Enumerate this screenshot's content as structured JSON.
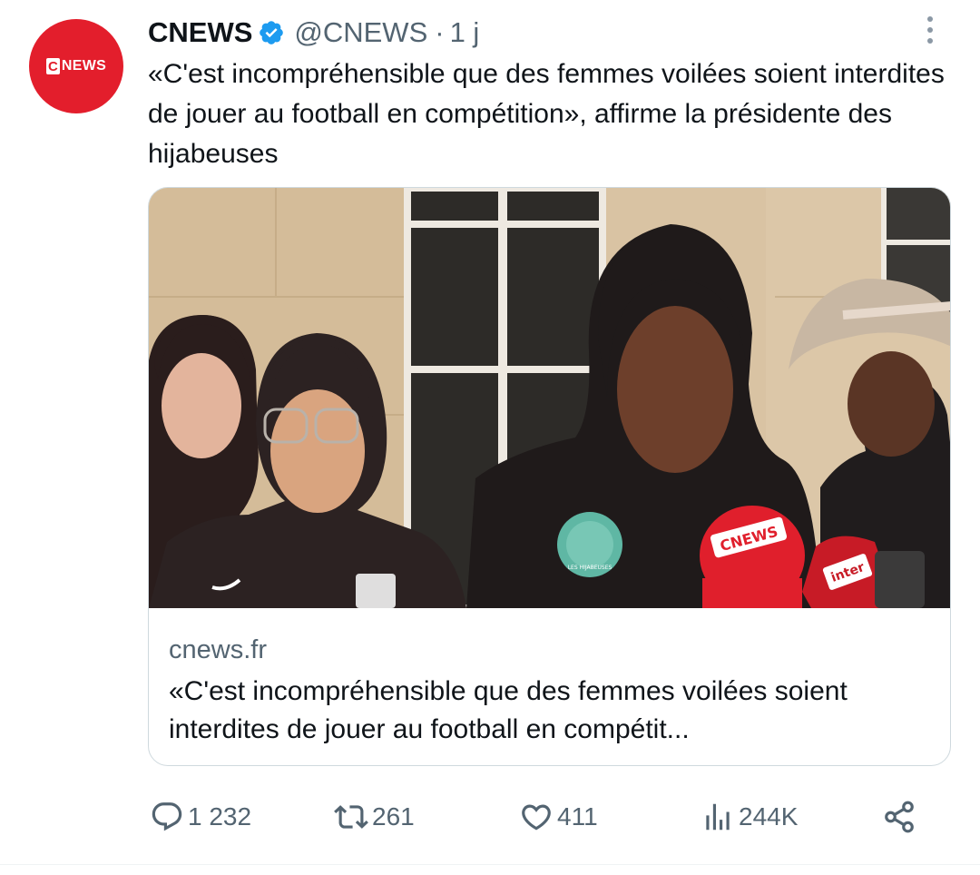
{
  "tweet": {
    "avatar": {
      "logo_c": "C",
      "logo_text": "NEWS",
      "bg_color": "#e31e2c"
    },
    "display_name": "CNEWS",
    "handle": "@CNEWS",
    "separator": "·",
    "timestamp": "1 j",
    "text": "«C'est incompréhensible que des femmes voilées soient interdites de jouer au football en compétition», affirme la présidente des hijabeuses",
    "verified_icon": "verified-badge-icon",
    "more_icon": "more-vertical-icon"
  },
  "card": {
    "domain": "cnews.fr",
    "title": "«C'est incompréhensible que des femmes voilées soient interdites de jouer au football en compétit...",
    "image": {
      "mic1_label": "CNEWS",
      "mic2_label": "inter",
      "badge_text": "LES HIJABEUSES"
    }
  },
  "actions": {
    "replies": "1 232",
    "reposts": "261",
    "likes": "411",
    "views": "244K",
    "icons": [
      "reply-icon",
      "repost-icon",
      "like-icon",
      "views-icon",
      "share-icon"
    ]
  },
  "colors": {
    "text_primary": "#0f1419",
    "text_secondary": "#536471",
    "verified": "#1d9bf0",
    "border": "#cfd9de"
  }
}
